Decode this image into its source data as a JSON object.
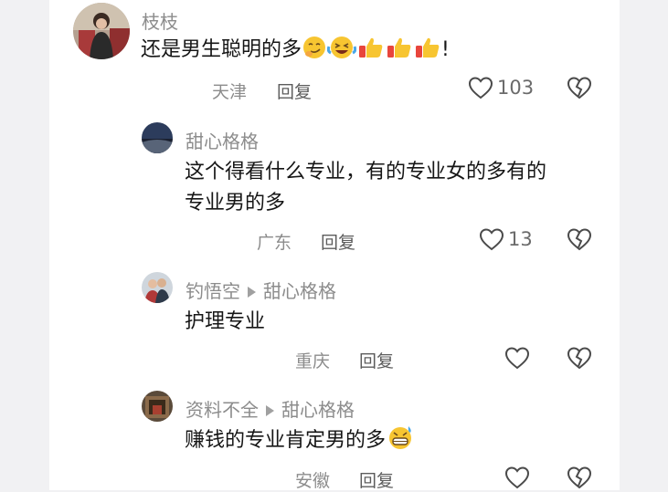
{
  "comments": [
    {
      "author": "枝枝",
      "text": "还是男生聪明的多",
      "text_suffix": "!",
      "location": "天津",
      "reply_label": "回复",
      "like_count": "103"
    },
    {
      "author": "甜心格格",
      "text_line1": "这个得看什么专业，有的专业女的多有的",
      "text_line2": "专业男的多",
      "location": "广东",
      "reply_label": "回复",
      "like_count": "13"
    },
    {
      "author": "钓悟空",
      "reply_to": "甜心格格",
      "text": "护理专业",
      "location": "重庆",
      "reply_label": "回复"
    },
    {
      "author": "资料不全",
      "reply_to": "甜心格格",
      "text": "赚钱的专业肯定男的多",
      "location": "安徽",
      "reply_label": "回复"
    }
  ],
  "icons": {
    "like": "heart-outline-icon",
    "dislike": "broken-heart-icon",
    "reply_arrow": "triangle-right-icon"
  },
  "colors": {
    "background": "#f1f1f3",
    "card": "#ffffff",
    "text": "#161616",
    "muted": "#8c8c8c"
  }
}
